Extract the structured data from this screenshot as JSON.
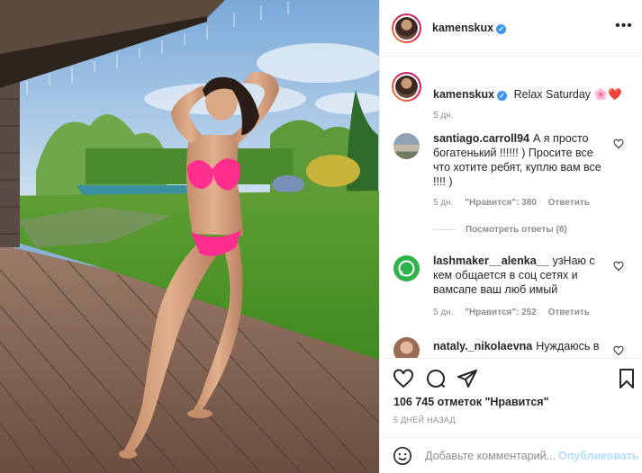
{
  "post": {
    "author": "kamenskux",
    "verified_mark": "✓"
  },
  "caption": {
    "username": "kamenskux",
    "text": "Relax Saturday",
    "emojis": "🌸❤️",
    "time": "5 дн."
  },
  "comments": [
    {
      "username": "santiago.carroll94",
      "text": "А я просто богатенький !!!!!! ) Просите все что хотите ребят, куплю вам все !!!! )",
      "time": "5 дн.",
      "likes": "\"Нравится\": 380",
      "reply_label": "Ответить",
      "avatar_icon": "landscape-avatar-icon"
    },
    {
      "username": "lashmaker__alenka__",
      "text": "узНаю с кем общается в соц сетях и вамсапе ваш люб имый",
      "time": "5 дн.",
      "likes": "\"Нравится\": 252",
      "reply_label": "Ответить",
      "avatar_icon": "whatsapp-icon"
    },
    {
      "username": "nataly._nikolaevna",
      "text": "Нуждаюсь в",
      "avatar_icon": "portrait-avatar-icon"
    }
  ],
  "view_replies_label": "Посмотреть ответы (8)",
  "likes_label": "106 745 отметок \"Нравится\"",
  "date_label": "5 ДНЕЙ НАЗАД",
  "add_comment": {
    "placeholder": "Добавьте комментарий...",
    "publish_label": "Опубликовать"
  },
  "icons": {
    "more": "more-options-icon",
    "like": "heart-icon",
    "comment": "comment-icon",
    "share": "share-icon",
    "save": "bookmark-icon",
    "emoji": "emoji-icon"
  },
  "colors": {
    "verified": "#3897f0",
    "publish": "#b2dffc",
    "muted": "#8e8e8e",
    "text": "#262626",
    "bikini": "#ff2d8e"
  }
}
